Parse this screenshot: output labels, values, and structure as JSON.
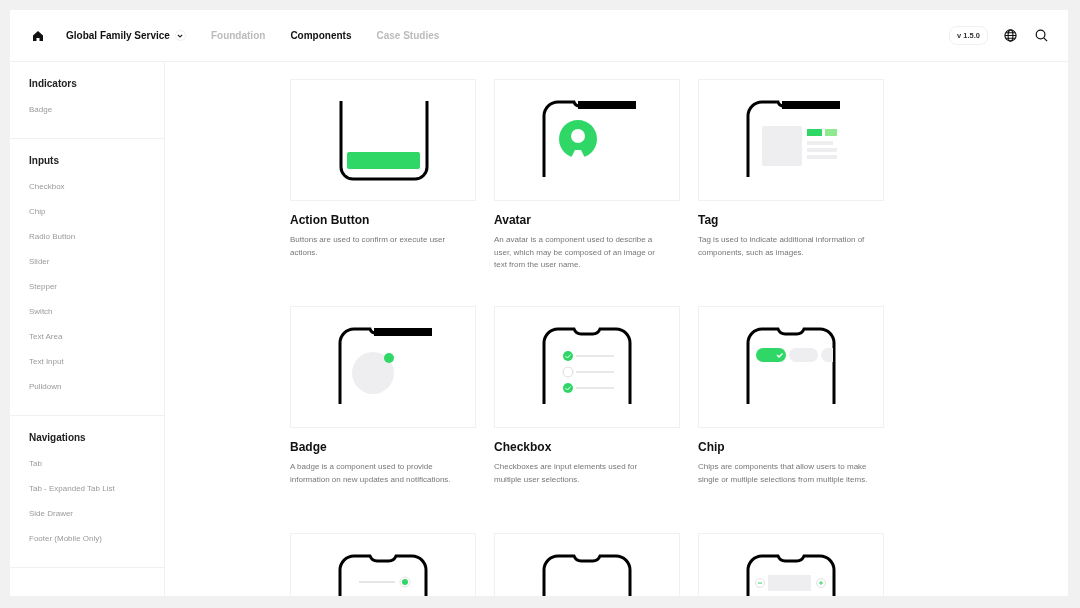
{
  "header": {
    "brand": "Global Family Service",
    "nav": [
      {
        "label": "Foundation",
        "selected": false
      },
      {
        "label": "Components",
        "selected": true
      },
      {
        "label": "Case Studies",
        "selected": false
      }
    ],
    "version": "v 1.5.0"
  },
  "sidebar": {
    "sections": [
      {
        "title": "Indicators",
        "items": [
          "Badge"
        ]
      },
      {
        "title": "Inputs",
        "items": [
          "Checkbox",
          "Chip",
          "Radio Button",
          "Slider",
          "Stepper",
          "Switch",
          "Text Area",
          "Text Input",
          "Pulldown"
        ]
      },
      {
        "title": "Navigations",
        "items": [
          "Tab",
          "Tab - Expanded Tab List",
          "Side Drawer",
          "Footer (Mobile Only)"
        ]
      }
    ]
  },
  "cards": [
    {
      "kind": "action-button",
      "title": "Action Button",
      "description": "Buttons are used to confirm or execute user actions."
    },
    {
      "kind": "avatar",
      "title": "Avatar",
      "description": "An avatar is a component used to describe a user, which may be composed of an image or text from the user name."
    },
    {
      "kind": "tag",
      "title": "Tag",
      "description": "Tag is used to indicate additional information of components, such as images."
    },
    {
      "kind": "badge",
      "title": "Badge",
      "description": "A badge is a component used to provide information on new updates and notifications."
    },
    {
      "kind": "checkbox",
      "title": "Checkbox",
      "description": "Checkboxes are input elements used for multiple user selections."
    },
    {
      "kind": "chip",
      "title": "Chip",
      "description": "Chips are components that allow users to make single or multiple selections from multiple items."
    },
    {
      "kind": "slider"
    },
    {
      "kind": "blank"
    },
    {
      "kind": "stepper"
    }
  ]
}
